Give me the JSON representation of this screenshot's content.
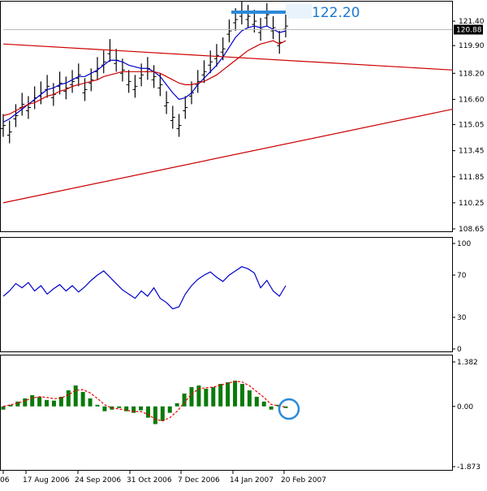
{
  "colors": {
    "background": "#ffffff",
    "border": "#000000",
    "grid": "#d8d8d8",
    "price_bar": "#000000",
    "ma_fast": "#0000cc",
    "ma_slow": "#cc0000",
    "trendline": "#cc0000",
    "rsi_line": "#0000cc",
    "macd_hist": "#0a7a0a",
    "macd_signal": "#ee0000",
    "highlight": "#2a8ad8",
    "price_tag_bg": "#000000",
    "price_tag_text": "#ffffff"
  },
  "annotations": {
    "resistance_label": "122.20",
    "circle_note": "MACD histogram crossing"
  },
  "chart_data": [
    {
      "type": "line",
      "panel": "price",
      "y_ticks": [
        "121.40",
        "119.90",
        "118.20",
        "116.60",
        "115.05",
        "113.45",
        "111.85",
        "110.25",
        "108.65"
      ],
      "ylim": [
        108.65,
        122.4
      ],
      "current_price": "120.88",
      "resistance": 122.2,
      "series": [
        {
          "y": [
            115.0,
            114.6,
            115.6,
            116.3,
            116.1,
            116.7,
            117.0,
            117.4,
            116.9,
            117.6,
            117.3,
            117.7,
            118.1,
            117.2,
            117.8,
            118.5,
            118.9,
            119.6,
            119.0,
            118.4,
            117.7,
            117.4,
            118.1,
            118.5,
            118.0,
            117.5,
            116.4,
            115.5,
            115.0,
            116.1,
            117.0,
            117.7,
            118.3,
            118.9,
            119.3,
            119.7,
            120.8,
            121.5,
            121.9,
            121.7,
            121.4,
            120.9,
            121.8,
            121.0,
            120.1,
            121.1
          ],
          "type": "ohlc"
        },
        {
          "y": [
            115.2,
            115.4,
            115.7,
            116.0,
            116.3,
            116.6,
            116.9,
            117.2,
            117.3,
            117.5,
            117.6,
            117.8,
            118.0,
            118.0,
            118.2,
            118.4,
            118.7,
            119.0,
            119.0,
            118.9,
            118.7,
            118.6,
            118.5,
            118.5,
            118.3,
            118.0,
            117.5,
            117.0,
            116.6,
            116.7,
            117.0,
            117.5,
            117.9,
            118.3,
            118.7,
            119.2,
            119.8,
            120.4,
            120.8,
            121.0,
            121.1,
            121.0,
            121.1,
            120.9,
            120.7,
            120.8
          ]
        },
        {
          "y": [
            115.6,
            115.7,
            115.9,
            116.1,
            116.3,
            116.4,
            116.6,
            116.8,
            116.9,
            117.1,
            117.2,
            117.4,
            117.5,
            117.6,
            117.7,
            117.8,
            118.0,
            118.1,
            118.2,
            118.3,
            118.3,
            118.3,
            118.3,
            118.3,
            118.3,
            118.2,
            118.0,
            117.8,
            117.6,
            117.5,
            117.5,
            117.6,
            117.7,
            117.9,
            118.1,
            118.4,
            118.7,
            119.0,
            119.3,
            119.6,
            119.8,
            120.0,
            120.1,
            120.2,
            120.0,
            120.2
          ]
        }
      ],
      "trendlines": [
        {
          "from": [
            0,
            120.0
          ],
          "to": [
            66,
            118.4
          ]
        },
        {
          "from": [
            0,
            110.25
          ],
          "to": [
            66,
            116.0
          ]
        }
      ]
    },
    {
      "type": "line",
      "panel": "rsi",
      "y_ticks": [
        "100",
        "70",
        "30",
        "0"
      ],
      "ylim": [
        0,
        100
      ],
      "series": [
        {
          "values": [
            50,
            55,
            62,
            58,
            63,
            55,
            60,
            52,
            57,
            61,
            55,
            60,
            54,
            59,
            65,
            70,
            74,
            68,
            62,
            56,
            52,
            48,
            55,
            50,
            58,
            48,
            44,
            38,
            40,
            52,
            60,
            66,
            70,
            73,
            68,
            64,
            70,
            74,
            78,
            76,
            72,
            58,
            65,
            55,
            50,
            60
          ]
        }
      ]
    },
    {
      "type": "bar",
      "panel": "macd",
      "y_ticks": [
        "1.382",
        "0.00",
        "-1.873"
      ],
      "ylim": [
        -1.873,
        1.382
      ],
      "series": [
        {
          "values": [
            -0.1,
            0.05,
            0.15,
            0.25,
            0.35,
            0.3,
            0.2,
            0.18,
            0.3,
            0.5,
            0.65,
            0.45,
            0.25,
            0.05,
            -0.15,
            -0.1,
            -0.05,
            -0.15,
            -0.2,
            -0.12,
            -0.35,
            -0.55,
            -0.45,
            -0.2,
            0.1,
            0.4,
            0.6,
            0.65,
            0.55,
            0.6,
            0.7,
            0.75,
            0.8,
            0.7,
            0.5,
            0.3,
            0.15,
            -0.1,
            0.05,
            -0.05
          ],
          "type": "histogram"
        },
        {
          "values": [
            0.0,
            0.05,
            0.1,
            0.18,
            0.26,
            0.3,
            0.28,
            0.24,
            0.26,
            0.36,
            0.5,
            0.52,
            0.42,
            0.25,
            0.05,
            -0.05,
            -0.08,
            -0.12,
            -0.16,
            -0.16,
            -0.25,
            -0.4,
            -0.45,
            -0.35,
            -0.15,
            0.12,
            0.38,
            0.55,
            0.58,
            0.6,
            0.66,
            0.72,
            0.78,
            0.76,
            0.64,
            0.46,
            0.28,
            0.06,
            0.02,
            -0.02
          ],
          "type": "signal"
        }
      ]
    }
  ],
  "x_axis": {
    "labels": [
      "06",
      "17 Aug 2006",
      "24 Sep 2006",
      "31 Oct 2006",
      "7 Dec 2006",
      "14 Jan 2007",
      "20 Feb 2007"
    ]
  }
}
